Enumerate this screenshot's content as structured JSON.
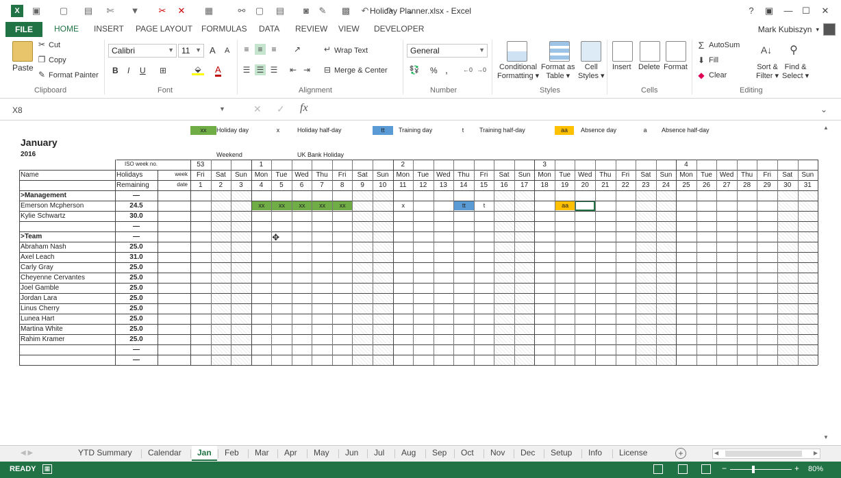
{
  "window": {
    "title": "Holiday Planner.xlsx - Excel",
    "help": "?",
    "user_name": "Mark Kubiszyn"
  },
  "ribbon_tabs": [
    "FILE",
    "HOME",
    "INSERT",
    "PAGE LAYOUT",
    "FORMULAS",
    "DATA",
    "REVIEW",
    "VIEW",
    "DEVELOPER"
  ],
  "ribbon": {
    "clipboard": {
      "paste": "Paste",
      "cut": "Cut",
      "copy": "Copy",
      "format_painter": "Format Painter",
      "group": "Clipboard"
    },
    "font": {
      "name": "Calibri",
      "size": "11",
      "bold": "B",
      "italic": "I",
      "underline": "U",
      "grow": "A",
      "shrink": "A",
      "color_letter": "A",
      "group": "Font"
    },
    "alignment": {
      "wrap_text": "Wrap Text",
      "merge_center": "Merge & Center",
      "group": "Alignment"
    },
    "number": {
      "format": "General",
      "percent": "%",
      "comma": ",",
      "group": "Number"
    },
    "styles": {
      "conditional": "Conditional",
      "formatting": "Formatting",
      "format_as": "Format as",
      "table": "Table",
      "cell": "Cell",
      "styles": "Styles",
      "group": "Styles"
    },
    "cells": {
      "insert": "Insert",
      "delete": "Delete",
      "format": "Format",
      "group": "Cells"
    },
    "editing": {
      "autosum": "AutoSum",
      "fill": "Fill",
      "clear": "Clear",
      "sort": "Sort &",
      "filter": "Filter",
      "find": "Find &",
      "select": "Select",
      "group": "Editing"
    }
  },
  "formula_bar": {
    "name_box": "X8",
    "fx": "fx",
    "value": ""
  },
  "legend": [
    {
      "code": "xx",
      "label": "Holiday day",
      "color": "#70ad47"
    },
    {
      "code": "x",
      "label": "Holiday half-day",
      "color": ""
    },
    {
      "code": "tt",
      "label": "Training day",
      "color": "#5b9bd5"
    },
    {
      "code": "t",
      "label": "Training half-day",
      "color": ""
    },
    {
      "code": "aa",
      "label": "Absence day",
      "color": "#ffc000"
    },
    {
      "code": "a",
      "label": "Absence half-day",
      "color": ""
    }
  ],
  "sheet": {
    "month": "January",
    "year": "2016",
    "weekend_label": "Weekend",
    "bank_holiday_label": "UK Bank Holiday",
    "iso_week_label": "ISO week no.",
    "week_label": "week",
    "date_label": "date",
    "headers": {
      "name": "Name",
      "holidays": "Holidays",
      "remaining": "Remaining"
    },
    "weeks": [
      {
        "day": 1,
        "label": "53"
      },
      {
        "day": 4,
        "label": "1"
      },
      {
        "day": 11,
        "label": "2"
      },
      {
        "day": 18,
        "label": "3"
      },
      {
        "day": 25,
        "label": "4"
      }
    ],
    "days": [
      "Fri",
      "Sat",
      "Sun",
      "Mon",
      "Tue",
      "Wed",
      "Thu",
      "Fri",
      "Sat",
      "Sun",
      "Mon",
      "Tue",
      "Wed",
      "Thu",
      "Fri",
      "Sat",
      "Sun",
      "Mon",
      "Tue",
      "Wed",
      "Thu",
      "Fri",
      "Sat",
      "Sun",
      "Mon",
      "Tue",
      "Wed",
      "Thu",
      "Fri",
      "Sat",
      "Sun"
    ],
    "dates": [
      "1",
      "2",
      "3",
      "4",
      "5",
      "6",
      "7",
      "8",
      "9",
      "10",
      "11",
      "12",
      "13",
      "14",
      "15",
      "16",
      "17",
      "18",
      "19",
      "20",
      "21",
      "22",
      "23",
      "24",
      "25",
      "26",
      "27",
      "28",
      "29",
      "30",
      "31"
    ],
    "rows": [
      {
        "name": ">Management",
        "remaining": "—",
        "bold": true
      },
      {
        "name": "Emerson Mcpherson",
        "remaining": "24.5"
      },
      {
        "name": "Kylie Schwartz",
        "remaining": "30.0"
      },
      {
        "name": "",
        "remaining": "—"
      },
      {
        "name": ">Team",
        "remaining": "—",
        "bold": true
      },
      {
        "name": "Abraham Nash",
        "remaining": "25.0"
      },
      {
        "name": "Axel Leach",
        "remaining": "31.0"
      },
      {
        "name": "Carly Gray",
        "remaining": "25.0"
      },
      {
        "name": "Cheyenne Cervantes",
        "remaining": "25.0"
      },
      {
        "name": "Joel Gamble",
        "remaining": "25.0"
      },
      {
        "name": "Jordan Lara",
        "remaining": "25.0"
      },
      {
        "name": "Linus Cherry",
        "remaining": "25.0"
      },
      {
        "name": "Lunea Hart",
        "remaining": "25.0"
      },
      {
        "name": "Martina White",
        "remaining": "25.0"
      },
      {
        "name": "Rahim Kramer",
        "remaining": "25.0"
      },
      {
        "name": "",
        "remaining": "—"
      },
      {
        "name": "",
        "remaining": "—"
      }
    ],
    "marks": [
      {
        "row": 1,
        "day": 4,
        "code": "xx",
        "color": "#70ad47"
      },
      {
        "row": 1,
        "day": 5,
        "code": "xx",
        "color": "#70ad47"
      },
      {
        "row": 1,
        "day": 6,
        "code": "xx",
        "color": "#70ad47"
      },
      {
        "row": 1,
        "day": 7,
        "code": "xx",
        "color": "#70ad47"
      },
      {
        "row": 1,
        "day": 8,
        "code": "xx",
        "color": "#70ad47"
      },
      {
        "row": 1,
        "day": 11,
        "code": "x",
        "color": ""
      },
      {
        "row": 1,
        "day": 14,
        "code": "tt",
        "color": "#5b9bd5"
      },
      {
        "row": 1,
        "day": 15,
        "code": "t",
        "color": ""
      },
      {
        "row": 1,
        "day": 19,
        "code": "aa",
        "color": "#ffc000"
      }
    ]
  },
  "sheet_tabs": [
    "YTD Summary",
    "Calendar",
    "Jan",
    "Feb",
    "Mar",
    "Apr",
    "May",
    "Jun",
    "Jul",
    "Aug",
    "Sep",
    "Oct",
    "Nov",
    "Dec",
    "Setup",
    "Info",
    "License"
  ],
  "active_tab": "Jan",
  "status": {
    "ready": "READY",
    "zoom": "80%"
  },
  "colors": {
    "excel_green": "#217346",
    "weekend_hatch": "#e6e6e6"
  }
}
